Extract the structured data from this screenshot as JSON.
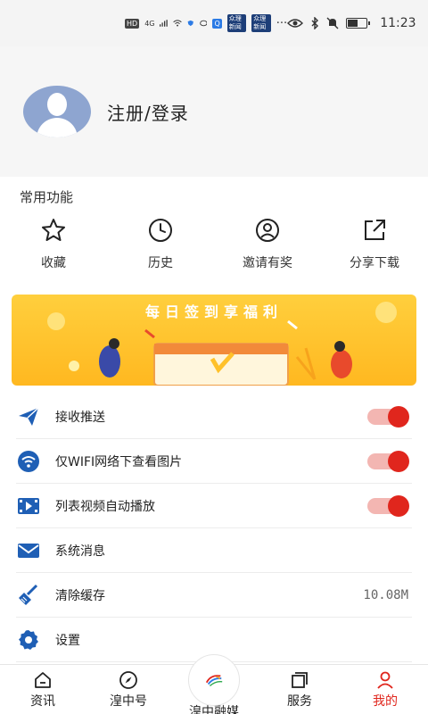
{
  "status_bar": {
    "hd": "HD",
    "net": "4G",
    "badge1": "众理新闻",
    "badge2": "众理新闻",
    "more": "···",
    "time": "11:23"
  },
  "profile": {
    "login_label": "注册/登录"
  },
  "common": {
    "title": "常用功能",
    "items": [
      {
        "label": "收藏",
        "icon": "star-icon"
      },
      {
        "label": "历史",
        "icon": "clock-icon"
      },
      {
        "label": "邀请有奖",
        "icon": "user-circle-icon"
      },
      {
        "label": "分享下载",
        "icon": "share-icon"
      }
    ]
  },
  "banner": {
    "title": "每日签到享福利"
  },
  "settings": {
    "items": [
      {
        "label": "接收推送",
        "icon": "send-icon",
        "toggle": true
      },
      {
        "label": "仅WIFI网络下查看图片",
        "icon": "wifi-icon",
        "toggle": true
      },
      {
        "label": "列表视频自动播放",
        "icon": "video-icon",
        "toggle": true
      },
      {
        "label": "系统消息",
        "icon": "mail-icon"
      },
      {
        "label": "清除缓存",
        "icon": "broom-icon",
        "value": "10.08M"
      },
      {
        "label": "设置",
        "icon": "gear-icon"
      }
    ]
  },
  "tabbar": {
    "items": [
      {
        "label": "资讯",
        "icon": "home-icon"
      },
      {
        "label": "湟中号",
        "icon": "compass-icon"
      },
      {
        "label": "湟中融媒",
        "icon": "logo-icon"
      },
      {
        "label": "服务",
        "icon": "cards-icon"
      },
      {
        "label": "我的",
        "icon": "person-icon",
        "active": true
      }
    ]
  },
  "colors": {
    "accent": "#e0261d",
    "icon_blue": "#1f5fb5",
    "banner_yellow": "#ffc12a"
  }
}
